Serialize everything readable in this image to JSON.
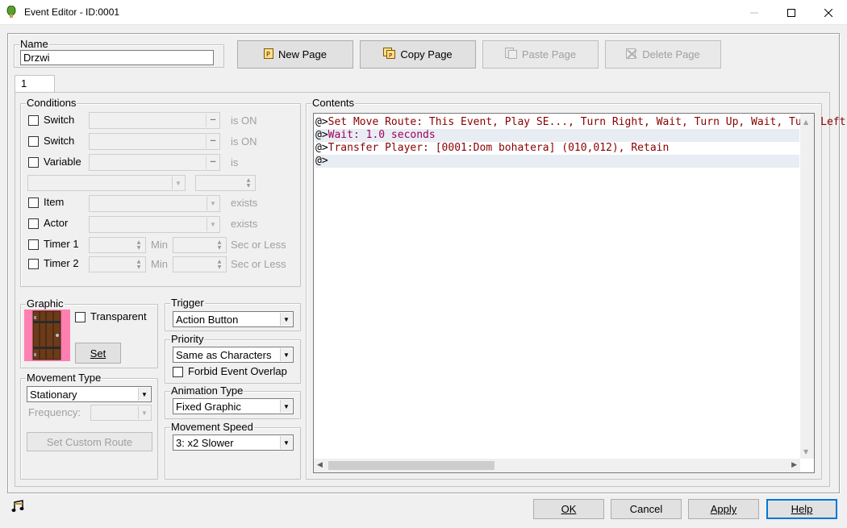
{
  "window": {
    "title": "Event Editor - ID:0001",
    "minimize_icon": "minimize-icon",
    "maximize_icon": "maximize-icon",
    "close_icon": "close-icon"
  },
  "name": {
    "label": "Name",
    "value": "Drzwi"
  },
  "toolbar": {
    "new_page": "New Page",
    "copy_page": "Copy Page",
    "paste_page": "Paste Page",
    "delete_page": "Delete Page"
  },
  "tabs": [
    {
      "label": "1"
    }
  ],
  "conditions": {
    "label": "Conditions",
    "switch1": {
      "label": "Switch",
      "suffix": "is ON"
    },
    "switch2": {
      "label": "Switch",
      "suffix": "is ON"
    },
    "variable": {
      "label": "Variable",
      "suffix": "is"
    },
    "item": {
      "label": "Item",
      "suffix": "exists"
    },
    "actor": {
      "label": "Actor",
      "suffix": "exists"
    },
    "timer1": {
      "label": "Timer 1",
      "min": "Min",
      "sec": "Sec or Less"
    },
    "timer2": {
      "label": "Timer 2",
      "min": "Min",
      "sec": "Sec or Less"
    }
  },
  "graphic": {
    "label": "Graphic",
    "transparent": "Transparent",
    "set": "Set"
  },
  "trigger": {
    "label": "Trigger",
    "value": "Action Button"
  },
  "priority": {
    "label": "Priority",
    "value": "Same as Characters",
    "forbid": "Forbid Event Overlap"
  },
  "movement_type": {
    "label": "Movement Type",
    "value": "Stationary",
    "frequency": "Frequency:",
    "custom_route": "Set Custom Route"
  },
  "animation_type": {
    "label": "Animation Type",
    "value": "Fixed Graphic"
  },
  "movement_speed": {
    "label": "Movement Speed",
    "value": "3: x2 Slower"
  },
  "contents": {
    "label": "Contents",
    "lines": [
      {
        "prefix": "@>",
        "text": "Set Move Route: This Event, Play SE..., Turn Right, Wait, Turn Up, Wait, Turn Left",
        "color": "#8b0000"
      },
      {
        "prefix": "@>",
        "text": "Wait: 1.0 seconds",
        "color": "#a0005a"
      },
      {
        "prefix": "@>",
        "text": "Transfer Player: [0001:Dom bohatera] (010,012), Retain",
        "color": "#8b0000"
      },
      {
        "prefix": "@>",
        "text": "",
        "color": "#000000"
      }
    ]
  },
  "footer": {
    "ok": "OK",
    "cancel": "Cancel",
    "apply": "Apply",
    "help": "Help",
    "music_icon": "music-note-icon"
  }
}
